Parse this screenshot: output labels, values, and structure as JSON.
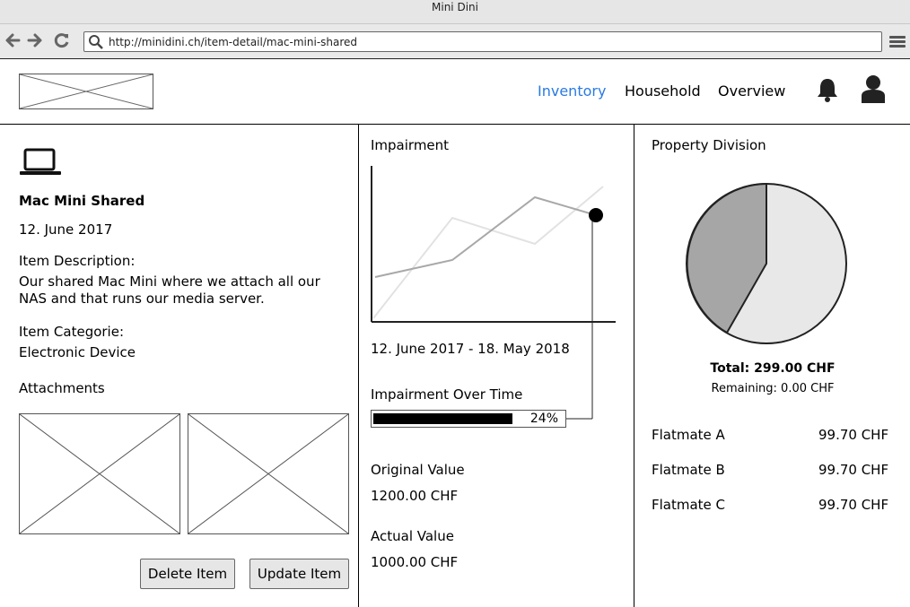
{
  "window": {
    "title": "Mini Dini"
  },
  "browser": {
    "url": "http://minidini.ch/item-detail/mac-mini-shared",
    "back_icon": "arrow-left-icon",
    "forward_icon": "arrow-right-icon",
    "reload_icon": "reload-icon"
  },
  "nav": {
    "items": [
      {
        "label": "Inventory",
        "active": true,
        "color": "#2a7ae2"
      },
      {
        "label": "Household",
        "active": false
      },
      {
        "label": "Overview",
        "active": false
      }
    ]
  },
  "item": {
    "icon": "laptop-icon",
    "name": "Mac Mini Shared",
    "date": "12. June 2017",
    "description_label": "Item Description:",
    "description_line1": "Our shared Mac Mini where we attach all our",
    "description_line2": "NAS and that runs our media server.",
    "category_label": "Item Categorie:",
    "category_value": "Electronic Device",
    "attachments_label": "Attachments",
    "delete_label": "Delete Item",
    "update_label": "Update Item"
  },
  "impairment": {
    "title": "Impairment",
    "date_range": "12. June 2017 - 18. May 2018",
    "over_time_label": "Impairment Over Time",
    "progress": 0.24,
    "progress_label": "24%",
    "original_label": "Original Value",
    "original_value": "1200.00 CHF",
    "actual_label": "Actual Value",
    "actual_value": "1000.00 CHF"
  },
  "division": {
    "title": "Property Division",
    "total": "Total: 299.00 CHF",
    "remaining": "Remaining: 0.00 CHF",
    "flatmates": [
      {
        "name": "Flatmate A",
        "amount": "99.70 CHF"
      },
      {
        "name": "Flatmate B",
        "amount": "99.70 CHF"
      },
      {
        "name": "Flatmate C",
        "amount": "99.70 CHF"
      }
    ]
  }
}
